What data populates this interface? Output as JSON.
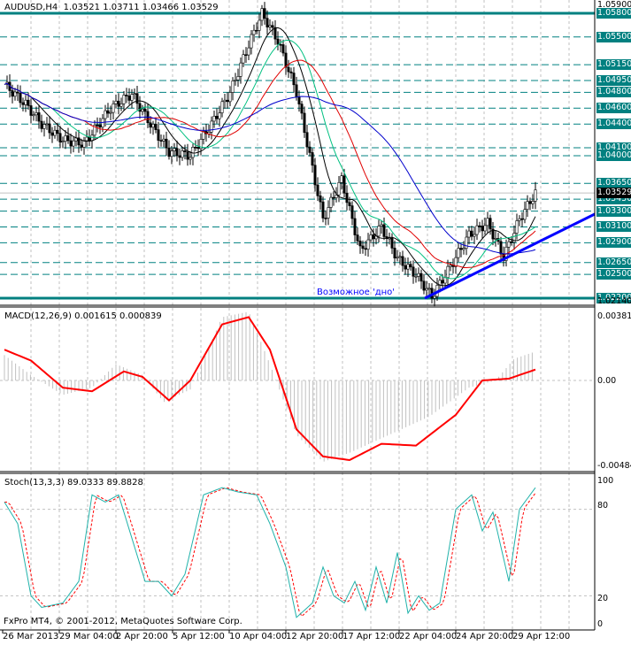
{
  "header": {
    "symbol": "AUDUSD,H4",
    "open": "1.03521",
    "high": "1.03711",
    "low": "1.03466",
    "close": "1.03529"
  },
  "copyright": "FxPro MT4, © 2001-2012, MetaQuotes Software Corp.",
  "annotation": "Возможное 'дно'",
  "colors": {
    "level": "#008080",
    "trend": "#0000ff",
    "ma_black": "#000000",
    "ma_red": "#e00000",
    "ma_blue": "#0000cc",
    "ma_green": "#00c080",
    "macd_signal": "#ff0000",
    "macd_hist": "#c0c0c0",
    "stoch_main": "#20b2aa",
    "stoch_signal": "#ff0000"
  },
  "chart_data": [
    {
      "type": "candlestick",
      "title": "AUDUSD,H4",
      "ylim": [
        1.0214,
        1.059
      ],
      "axis_top": "1.05900",
      "axis_bottom": "1.02140",
      "current_price": "1.03529",
      "levels": [
        "1.05800",
        "1.05500",
        "1.05150",
        "1.04950",
        "1.04800",
        "1.04600",
        "1.04400",
        "1.04100",
        "1.04000",
        "1.03650",
        "1.03450",
        "1.03300",
        "1.03100",
        "1.02900",
        "1.02650",
        "1.02500",
        "1.02200"
      ],
      "close_path": [
        [
          0,
          1.049
        ],
        [
          8,
          1.0465
        ],
        [
          14,
          1.044
        ],
        [
          22,
          1.042
        ],
        [
          30,
          1.0415
        ],
        [
          40,
          1.046
        ],
        [
          48,
          1.0478
        ],
        [
          55,
          1.044
        ],
        [
          62,
          1.0405
        ],
        [
          70,
          1.04
        ],
        [
          78,
          1.044
        ],
        [
          85,
          1.048
        ],
        [
          92,
          1.054
        ],
        [
          97,
          1.058
        ],
        [
          103,
          1.0545
        ],
        [
          110,
          1.048
        ],
        [
          115,
          1.04
        ],
        [
          120,
          1.032
        ],
        [
          127,
          1.037
        ],
        [
          134,
          1.028
        ],
        [
          142,
          1.031
        ],
        [
          148,
          1.027
        ],
        [
          155,
          1.025
        ],
        [
          161,
          1.0222
        ],
        [
          168,
          1.026
        ],
        [
          175,
          1.03
        ],
        [
          182,
          1.0315
        ],
        [
          188,
          1.0272
        ],
        [
          194,
          1.032
        ],
        [
          200,
          1.0353
        ]
      ],
      "x_ticks": [
        "26 Mar 2013",
        "29 Mar 04:00",
        "2 Apr 20:00",
        "5 Apr 12:00",
        "10 Apr 04:00",
        "12 Apr 20:00",
        "17 Apr 12:00",
        "22 Apr 04:00",
        "24 Apr 20:00",
        "29 Apr 12:00"
      ]
    },
    {
      "type": "line",
      "title": "MACD(12,26,9) 0.001615 0.000839",
      "ylim": [
        -0.00484,
        0.003814
      ],
      "axis_labels": [
        "0.003814",
        "0.00",
        "-0.00484"
      ],
      "signal_path": [
        [
          0,
          0.0017
        ],
        [
          10,
          0.0011
        ],
        [
          22,
          -0.0004
        ],
        [
          33,
          -0.0006
        ],
        [
          45,
          0.0005
        ],
        [
          52,
          0.0002
        ],
        [
          62,
          -0.0011
        ],
        [
          70,
          0.0
        ],
        [
          82,
          0.0031
        ],
        [
          92,
          0.0035
        ],
        [
          100,
          0.0017
        ],
        [
          110,
          -0.0027
        ],
        [
          120,
          -0.0042
        ],
        [
          130,
          -0.0044
        ],
        [
          142,
          -0.0035
        ],
        [
          155,
          -0.0036
        ],
        [
          170,
          -0.0019
        ],
        [
          180,
          0.0
        ],
        [
          190,
          0.0001
        ],
        [
          200,
          0.0006
        ]
      ],
      "hist_path": [
        [
          0,
          0.0014
        ],
        [
          10,
          0.0003
        ],
        [
          22,
          -0.0008
        ],
        [
          33,
          -0.0004
        ],
        [
          42,
          0.0009
        ],
        [
          52,
          0.0003
        ],
        [
          60,
          -0.0012
        ],
        [
          70,
          -0.0005
        ],
        [
          82,
          0.0035
        ],
        [
          92,
          0.0038
        ],
        [
          100,
          0.0009
        ],
        [
          110,
          -0.003
        ],
        [
          120,
          -0.0045
        ],
        [
          130,
          -0.004
        ],
        [
          145,
          -0.003
        ],
        [
          160,
          -0.002
        ],
        [
          175,
          -0.0004
        ],
        [
          185,
          0.0
        ],
        [
          192,
          0.0012
        ],
        [
          200,
          0.0016
        ]
      ]
    },
    {
      "type": "line",
      "title": "Stoch(13,3,3) 89.0333 89.8828",
      "ylim": [
        0,
        100
      ],
      "axis_labels": [
        "100",
        "80",
        "20",
        "0"
      ],
      "main_path": [
        [
          0,
          85
        ],
        [
          5,
          70
        ],
        [
          10,
          20
        ],
        [
          14,
          12
        ],
        [
          22,
          15
        ],
        [
          28,
          30
        ],
        [
          33,
          90
        ],
        [
          38,
          85
        ],
        [
          43,
          90
        ],
        [
          48,
          60
        ],
        [
          53,
          30
        ],
        [
          58,
          30
        ],
        [
          63,
          20
        ],
        [
          68,
          35
        ],
        [
          75,
          90
        ],
        [
          82,
          95
        ],
        [
          88,
          92
        ],
        [
          95,
          90
        ],
        [
          100,
          70
        ],
        [
          106,
          40
        ],
        [
          110,
          5
        ],
        [
          116,
          15
        ],
        [
          120,
          40
        ],
        [
          124,
          20
        ],
        [
          128,
          15
        ],
        [
          132,
          30
        ],
        [
          136,
          10
        ],
        [
          140,
          40
        ],
        [
          144,
          15
        ],
        [
          148,
          50
        ],
        [
          152,
          8
        ],
        [
          156,
          20
        ],
        [
          160,
          10
        ],
        [
          164,
          15
        ],
        [
          170,
          80
        ],
        [
          176,
          90
        ],
        [
          180,
          65
        ],
        [
          184,
          78
        ],
        [
          190,
          30
        ],
        [
          194,
          80
        ],
        [
          200,
          95
        ]
      ]
    }
  ]
}
